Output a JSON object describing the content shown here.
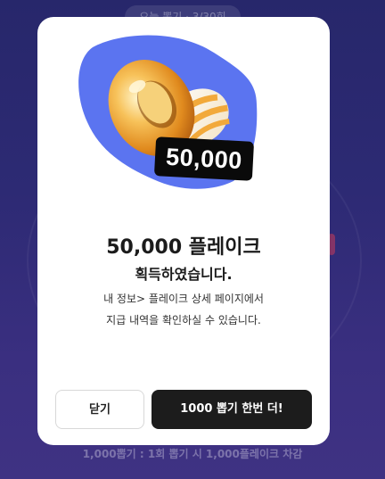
{
  "background": {
    "top_pill_text": "오늘 뽑기 · 3/30회",
    "footnote": "1,000뽑기 : 1회 뽑기 시 1,000플레이크 차감"
  },
  "modal": {
    "badge_amount": "50,000",
    "title": "50,000 플레이크",
    "subtitle": "획득하였습니다.",
    "description_line1": "내 정보> 플레이크 상세 페이지에서",
    "description_line2": "지급 내역을 확인하실 수 있습니다.",
    "close_button": "닫기",
    "draw_again_button": "1000 뽑기 한번 더!",
    "illustration_icon": "golden-pretzel-icon"
  },
  "colors": {
    "backdrop": "#2d2a74",
    "blob": "#5b74f0",
    "pretzel": "#f0a936",
    "badge": "#0a0a0a",
    "primary_button": "#1c1c1c"
  }
}
